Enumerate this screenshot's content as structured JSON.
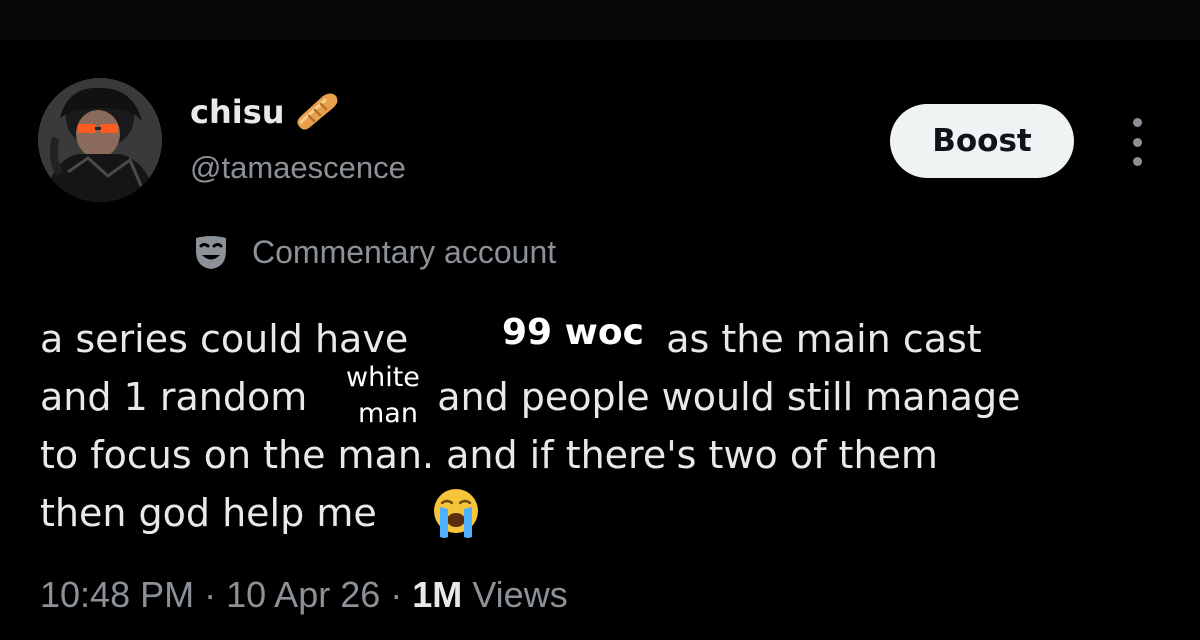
{
  "author": {
    "display_name": "chisu",
    "name_emoji": "bread-emoji",
    "handle": "@tamaescence",
    "avatar": "avatar-photo"
  },
  "actions": {
    "boost_label": "Boost",
    "more_icon": "more-vertical-icon"
  },
  "account_label": {
    "icon": "mask-icon",
    "text": "Commentary account"
  },
  "post": {
    "line1_start": "a series could have",
    "line1_end": "as the main cast",
    "line2_start": "and 1 random",
    "line2_end": "and people would still manage",
    "line3": "to focus on the man. and if there's two of them",
    "line4": "then god help me",
    "emoji": "loudly-crying-face-emoji",
    "overlay_woc": "99 woc",
    "overlay_white": "white",
    "overlay_man": "man"
  },
  "meta": {
    "time": "10:48 PM",
    "separator": "·",
    "date": "10 Apr 26",
    "views_count": "1M",
    "views_label": "Views"
  },
  "colors": {
    "background": "#000000",
    "text_primary": "#e7e9ea",
    "text_secondary": "#8b9197",
    "button_bg": "#eff3f4",
    "button_text": "#0f1419"
  }
}
